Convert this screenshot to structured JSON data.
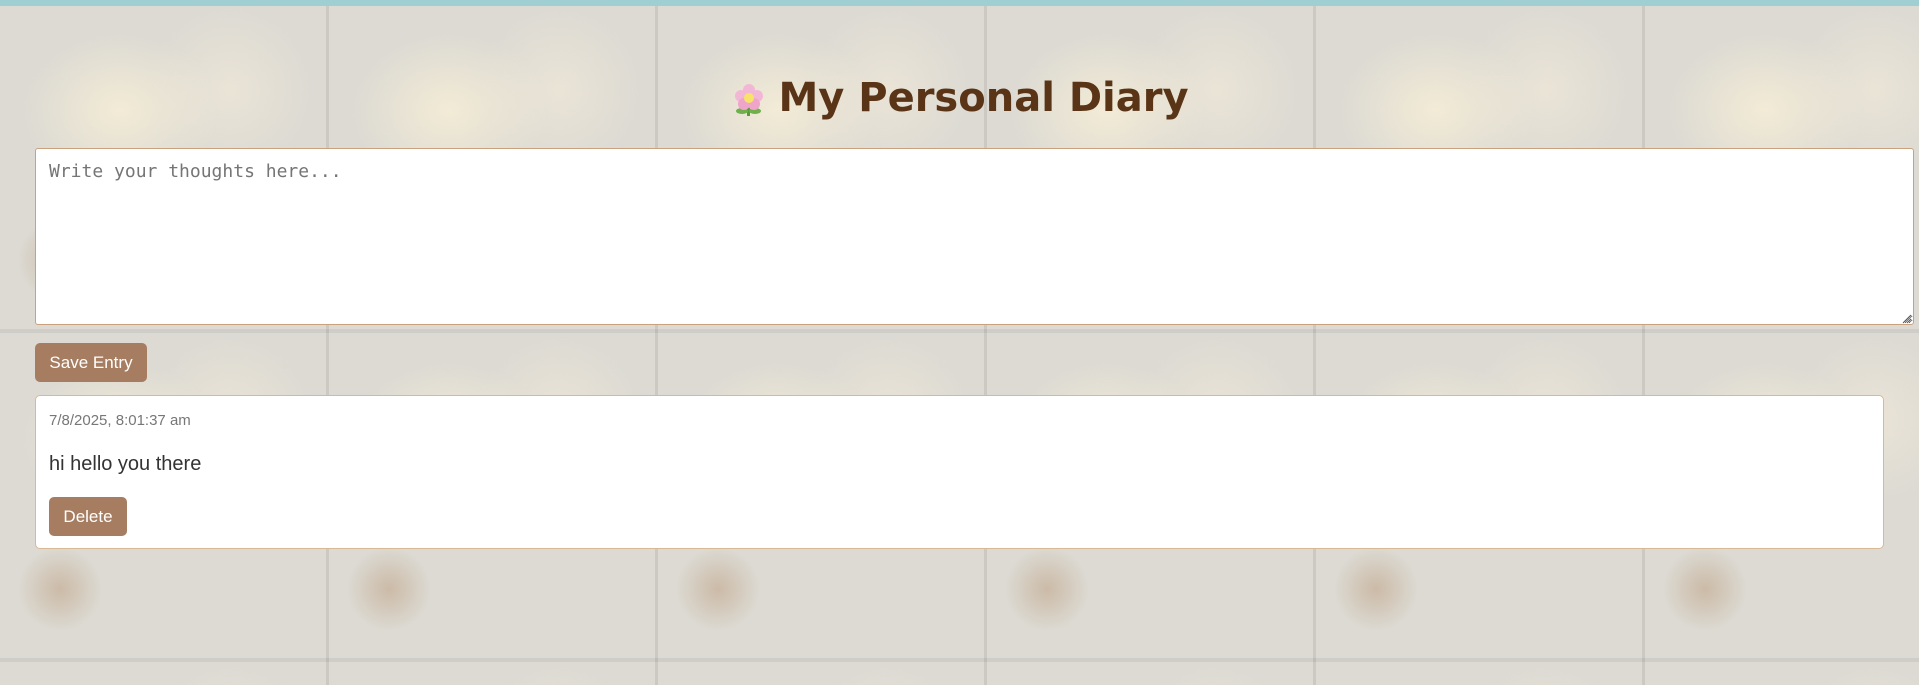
{
  "header": {
    "title": "My Personal Diary",
    "icon": "flower-icon"
  },
  "editor": {
    "placeholder": "Write your thoughts here...",
    "value": ""
  },
  "actions": {
    "save_label": "Save Entry"
  },
  "entries": [
    {
      "timestamp": "7/8/2025, 8:01:37 am",
      "text": "hi hello you there",
      "delete_label": "Delete"
    }
  ],
  "colors": {
    "title": "#5a3416",
    "button": "#a67d61",
    "border": "#c9a17f",
    "top_bar": "#9fcfd3"
  }
}
